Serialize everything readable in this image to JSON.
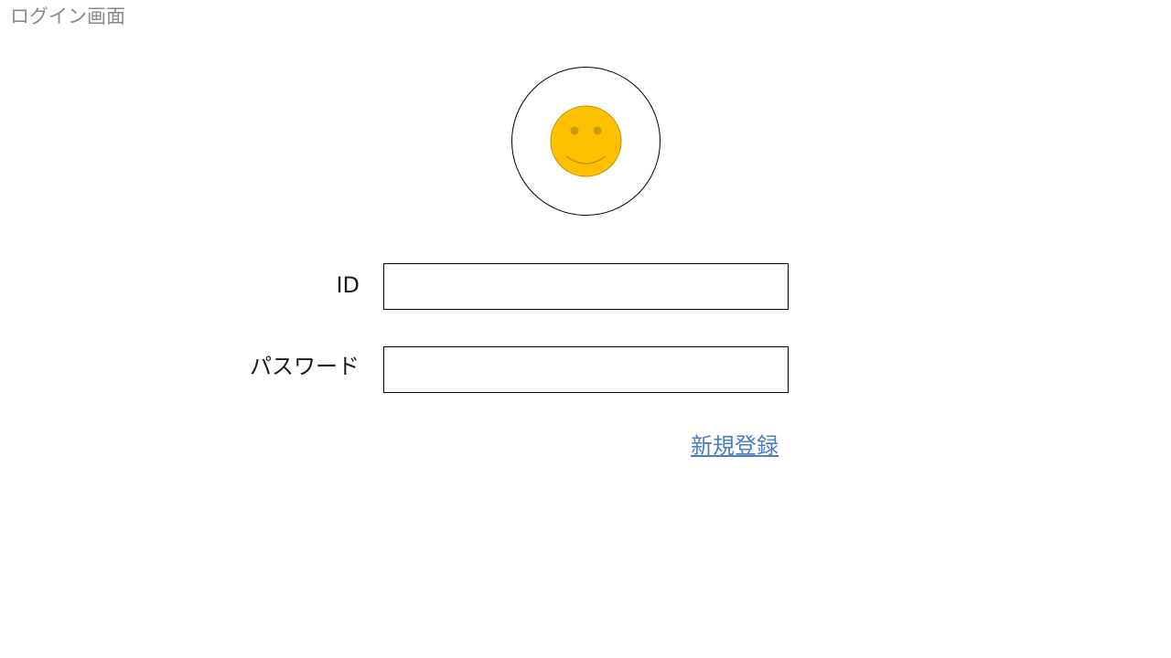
{
  "page": {
    "title": "ログイン画面"
  },
  "avatar": {
    "icon": "smiley-face-icon",
    "face_color": "#FFC000",
    "face_stroke": "#BF9000"
  },
  "form": {
    "id_label": "ID",
    "id_value": "",
    "password_label": "パスワード",
    "password_value": ""
  },
  "links": {
    "signup_label": "新規登録",
    "link_color": "#4A7DBF"
  }
}
